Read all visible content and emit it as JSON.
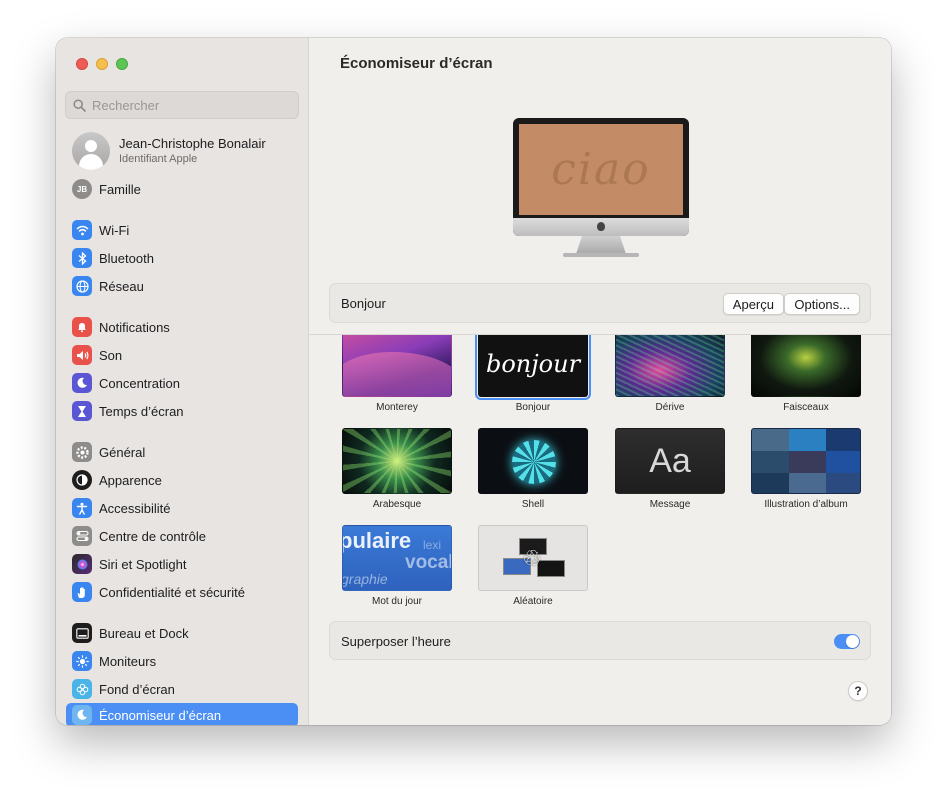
{
  "sidebar": {
    "search_placeholder": "Rechercher",
    "account": {
      "name": "Jean-Christophe Bonalair",
      "subtitle": "Identifiant Apple"
    },
    "family": {
      "initials": "JB",
      "label": "Famille"
    },
    "items": [
      {
        "label": "Wi-Fi",
        "icon": "wifi-icon",
        "color": "#3a86f0"
      },
      {
        "label": "Bluetooth",
        "icon": "bluetooth-icon",
        "color": "#3a86f0"
      },
      {
        "label": "Réseau",
        "icon": "globe-icon",
        "color": "#3a86f0"
      },
      {
        "label": "Notifications",
        "icon": "bell-icon",
        "color": "#e9524a"
      },
      {
        "label": "Son",
        "icon": "speaker-icon",
        "color": "#e9524a"
      },
      {
        "label": "Concentration",
        "icon": "moon-icon",
        "color": "#5b57d4"
      },
      {
        "label": "Temps d’écran",
        "icon": "hourglass-icon",
        "color": "#5b57d4"
      },
      {
        "label": "Général",
        "icon": "gear-icon",
        "color": "#8e8c8a"
      },
      {
        "label": "Apparence",
        "icon": "appearance-icon",
        "color": "#1d1d1d"
      },
      {
        "label": "Accessibilité",
        "icon": "accessibility-icon",
        "color": "#3a86f0"
      },
      {
        "label": "Centre de contrôle",
        "icon": "control-center-icon",
        "color": "#8e8c8a"
      },
      {
        "label": "Siri et Spotlight",
        "icon": "siri-icon",
        "color": "#b43ad6"
      },
      {
        "label": "Confidentialité et sécurité",
        "icon": "hand-icon",
        "color": "#3a86f0"
      },
      {
        "label": "Bureau et Dock",
        "icon": "dock-icon",
        "color": "#1d1d1d"
      },
      {
        "label": "Moniteurs",
        "icon": "sun-icon",
        "color": "#3a86f0"
      },
      {
        "label": "Fond d’écran",
        "icon": "wallpaper-icon",
        "color": "#4ab4e8"
      },
      {
        "label": "Économiseur d’écran",
        "icon": "screensaver-icon",
        "color": "#6fb6f0"
      }
    ]
  },
  "main": {
    "title": "Économiseur d’écran",
    "preview_text": "ciao",
    "current": {
      "label": "Bonjour",
      "preview_button": "Aperçu",
      "options_button": "Options..."
    },
    "savers": [
      {
        "name": "Monterey",
        "thumb": "t-monterey"
      },
      {
        "name": "Bonjour",
        "thumb": "t-bonjour",
        "text": "bonjour",
        "selected": true
      },
      {
        "name": "Dérive",
        "thumb": "t-derive"
      },
      {
        "name": "Faisceaux",
        "thumb": "t-faisceaux"
      },
      {
        "name": "Arabesque",
        "thumb": "t-arabesque"
      },
      {
        "name": "Shell",
        "thumb": "t-shell"
      },
      {
        "name": "Message",
        "thumb": "t-message",
        "text": "Aa"
      },
      {
        "name": "Illustration d’album",
        "thumb": "t-album"
      },
      {
        "name": "Mot du jour",
        "thumb": "t-motdujour"
      },
      {
        "name": "Aléatoire",
        "thumb": "t-aleatoire"
      }
    ],
    "show_clock": {
      "label": "Superposer l’heure",
      "enabled": true
    },
    "help_label": "?"
  },
  "colors": {
    "accent": "#4b8ff4",
    "sidebar_bg": "#e7e4e1",
    "window_bg": "#f1efec"
  }
}
